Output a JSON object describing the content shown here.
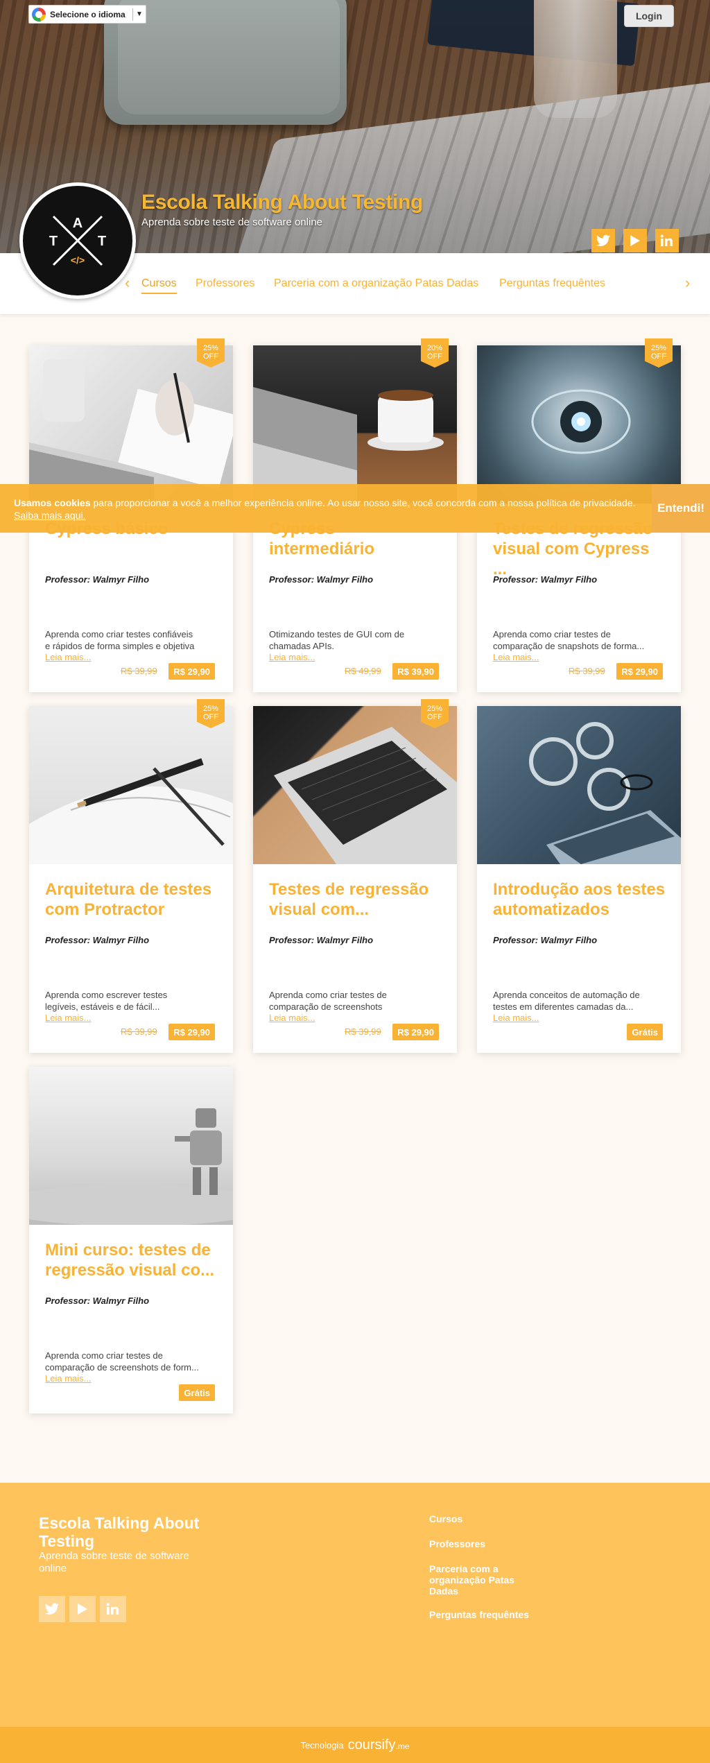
{
  "topbar": {
    "language_label": "Selecione o idioma",
    "language_arrow": "▼",
    "login_label": "Login"
  },
  "logo": {
    "letters": [
      "T",
      "A",
      "T"
    ],
    "code": "</>"
  },
  "header": {
    "title": "Escola Talking About Testing",
    "subtitle": "Aprenda sobre teste de software online"
  },
  "nav": {
    "prev": "‹",
    "next": "›",
    "items": [
      "Cursos",
      "Professores",
      "Parceria com a organização Patas Dadas",
      "Perguntas frequêntes"
    ]
  },
  "cookie": {
    "bold": "Usamos cookies",
    "text": " para proporcionar a você a melhor experiência online. Ao usar nosso site, você concorda com a nossa política de privacidade.",
    "link": "Saiba mais aqui.",
    "button": "Entendi!"
  },
  "courses": [
    {
      "badge": "25% OFF",
      "title": "Cypress básico",
      "professor": "Professor: Walmyr Filho",
      "desc1": "Aprenda como criar testes confiáveis",
      "desc2": "e rápidos de forma simples e objetiva",
      "more": "Leia mais...",
      "old_price": "R$ 39,99",
      "price": "R$ 29,90"
    },
    {
      "badge": "20% OFF",
      "title": "Cypress intermediário",
      "professor": "Professor: Walmyr Filho",
      "desc1": "Otimizando testes de GUI com de",
      "desc2": "chamadas APIs.",
      "more": "Leia mais...",
      "old_price": "R$ 49,99",
      "price": "R$ 39,90"
    },
    {
      "badge": "25% OFF",
      "title": "Testes de regressão visual com Cypress ...",
      "professor": "Professor: Walmyr Filho",
      "desc1": "Aprenda como criar testes de",
      "desc2": "comparação de snapshots de forma...",
      "more": "Leia mais...",
      "old_price": "R$ 39,99",
      "price": "R$ 29,90"
    },
    {
      "badge": "25% OFF",
      "title": "Arquitetura de testes com Protractor",
      "professor": "Professor: Walmyr Filho",
      "desc1": "Aprenda como escrever testes",
      "desc2": "legíveis, estáveis e de fácil...",
      "more": "Leia mais...",
      "old_price": "R$ 39,99",
      "price": "R$ 29,90"
    },
    {
      "badge": "25% OFF",
      "title": "Testes de regressão visual com...",
      "professor": "Professor: Walmyr Filho",
      "desc1": "Aprenda como criar testes de",
      "desc2": "comparação de screenshots",
      "more": "Leia mais...",
      "old_price": "R$ 39,99",
      "price": "R$ 29,90"
    },
    {
      "badge": "",
      "title": "Introdução aos testes automatizados",
      "professor": "Professor: Walmyr Filho",
      "desc1": "Aprenda conceitos de automação de",
      "desc2": "testes em diferentes camadas da...",
      "more": "Leia mais...",
      "old_price": "",
      "price": "Grátis"
    },
    {
      "badge": "",
      "title": "Mini curso: testes de regressão visual co...",
      "professor": "Professor: Walmyr Filho",
      "desc1": "Aprenda como criar testes de",
      "desc2": "comparação de screenshots de form...",
      "more": "Leia mais...",
      "old_price": "",
      "price": "Grátis"
    }
  ],
  "footer": {
    "title": "Escola Talking About Testing",
    "subtitle": "Aprenda sobre teste de software online",
    "links": [
      "Cursos",
      "Professores",
      "Parceria com a organização Patas Dadas",
      "Perguntas frequêntes"
    ],
    "tech_label": "Tecnologia",
    "brand": "coursify",
    "brand_suffix": ".me"
  },
  "colors": {
    "accent": "#f9b233",
    "footer": "#ffc35c",
    "page_bg": "#fdf8f1"
  },
  "icons": [
    "google-icon",
    "twitter-icon",
    "youtube-icon",
    "linkedin-icon",
    "chevron-left-icon",
    "chevron-right-icon"
  ]
}
